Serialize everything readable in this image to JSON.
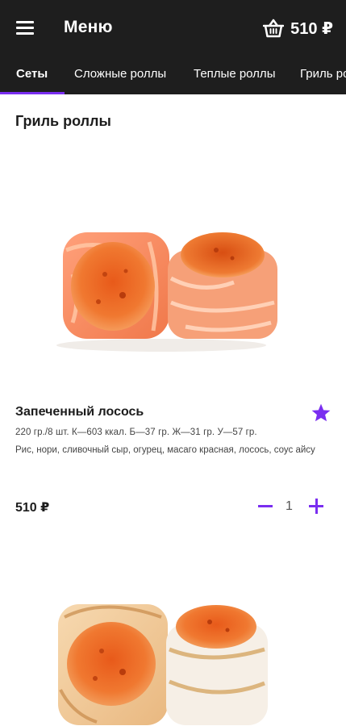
{
  "header": {
    "menu_icon": "hamburger-icon",
    "title": "Меню",
    "cart_icon": "basket-icon",
    "cart_total": "510 ₽"
  },
  "tabs": [
    {
      "label": "Сеты",
      "active": true
    },
    {
      "label": "Сложные роллы",
      "active": false
    },
    {
      "label": "Теплые роллы",
      "active": false
    },
    {
      "label": "Гриль роллы",
      "active": false
    }
  ],
  "accent_color": "#7a2ef0",
  "section": {
    "title": "Гриль роллы"
  },
  "products": [
    {
      "name": "Запеченный лосось",
      "spec": "220 гр./8 шт.  К—603 ккал. Б—37 гр. Ж—31 гр. У—57 гр.",
      "description": "Рис, нори, сливочный сыр,  огурец, масаго красная, лосось, соус айсу",
      "price": "510 ₽",
      "quantity": "1",
      "favorite": true,
      "favorite_icon": "star-icon",
      "minus_icon": "minus-icon",
      "plus_icon": "plus-icon"
    }
  ]
}
